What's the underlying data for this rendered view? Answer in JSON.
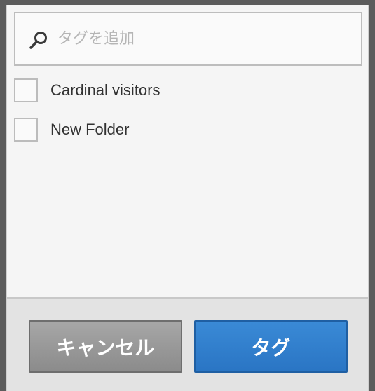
{
  "search": {
    "placeholder": "タグを追加",
    "icon": "search-icon"
  },
  "tags": [
    {
      "label": "Cardinal visitors",
      "checked": false
    },
    {
      "label": "New Folder",
      "checked": false
    }
  ],
  "buttons": {
    "cancel_label": "キャンセル",
    "tag_label": "タグ"
  },
  "colors": {
    "primary": "#2f7fcf",
    "secondary": "#9a9a9a"
  }
}
